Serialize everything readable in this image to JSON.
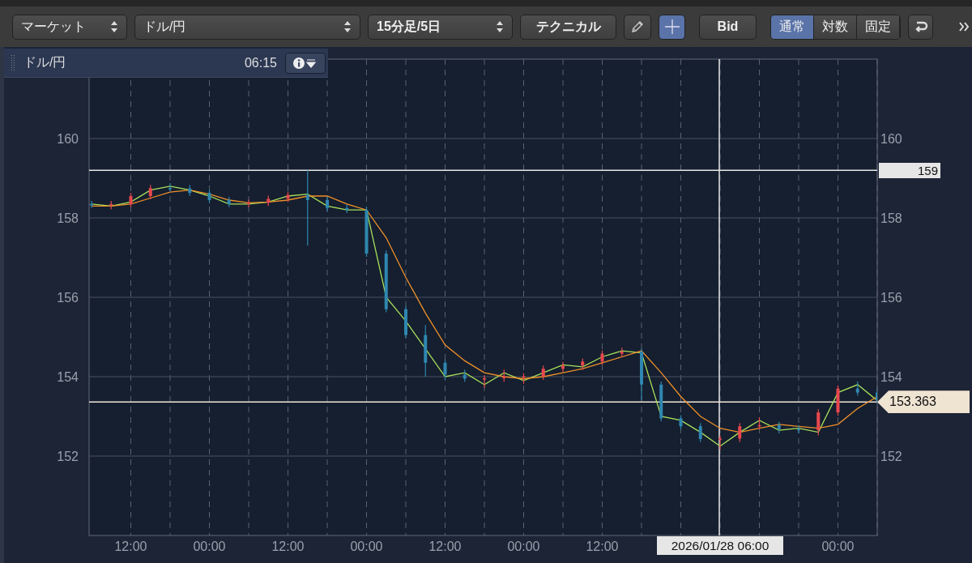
{
  "toolbar": {
    "market_select": "マーケット",
    "pair_select": "ドル/円",
    "period_select": "15分足/5日",
    "technical_button": "テクニカル",
    "draw_tool": {
      "selected": false
    },
    "crosshair_tool": {
      "selected": true
    },
    "price_button": "Bid",
    "scale_modes": [
      {
        "label": "通常",
        "selected": true
      },
      {
        "label": "対数",
        "selected": false
      },
      {
        "label": "固定",
        "selected": false
      }
    ]
  },
  "info_bar": {
    "pair": "ドル/円",
    "time": "06:15"
  },
  "chart": {
    "left_y_labels": [
      "160",
      "158",
      "156",
      "154",
      "152"
    ],
    "right_y_labels": [
      "160",
      "158",
      "156",
      "154",
      "152"
    ],
    "crosshair": {
      "price_label": "159",
      "time_label": "2026/01/28 06:00"
    },
    "last_price": {
      "label": "153.363"
    },
    "chart_data": {
      "type": "candlestick",
      "categories": [
        null,
        null,
        "12:00",
        null,
        null,
        null,
        "00:00",
        null,
        null,
        null,
        "12:00",
        null,
        null,
        null,
        "00:00",
        null,
        null,
        null,
        "12:00",
        null,
        null,
        null,
        "00:00",
        null,
        null,
        null,
        "12:00",
        null,
        null,
        null,
        null,
        null,
        null,
        null,
        null,
        null,
        null,
        null,
        "00:00",
        null,
        null
      ],
      "ohlc": [
        [
          158.35,
          158.43,
          158.25,
          158.33
        ],
        [
          158.33,
          158.43,
          158.22,
          158.35
        ],
        [
          158.35,
          158.63,
          158.27,
          158.55
        ],
        [
          158.55,
          158.83,
          158.47,
          158.75
        ],
        [
          158.75,
          158.88,
          158.67,
          158.74
        ],
        [
          158.74,
          158.83,
          158.55,
          158.63
        ],
        [
          158.63,
          158.71,
          158.37,
          158.45
        ],
        [
          158.45,
          158.53,
          158.27,
          158.35
        ],
        [
          158.35,
          158.46,
          158.27,
          158.38
        ],
        [
          158.38,
          158.56,
          158.3,
          158.48
        ],
        [
          158.48,
          158.66,
          158.4,
          158.58
        ],
        [
          158.58,
          159.2,
          157.3,
          158.45
        ],
        [
          158.45,
          158.53,
          158.17,
          158.25
        ],
        [
          158.25,
          158.33,
          158.12,
          158.2
        ],
        [
          158.2,
          158.28,
          157.02,
          157.1
        ],
        [
          157.1,
          157.18,
          155.62,
          155.7
        ],
        [
          155.7,
          155.78,
          154.97,
          155.05
        ],
        [
          155.05,
          155.3,
          154.0,
          154.35
        ],
        [
          154.35,
          154.43,
          153.92,
          154.05
        ],
        [
          154.05,
          154.18,
          153.87,
          153.95
        ],
        [
          153.95,
          154.03,
          153.72,
          153.96
        ],
        [
          153.96,
          154.18,
          153.87,
          154.0
        ],
        [
          154.0,
          154.09,
          153.82,
          154.01
        ],
        [
          154.01,
          154.28,
          153.92,
          154.2
        ],
        [
          154.2,
          154.38,
          154.12,
          154.28
        ],
        [
          154.28,
          154.46,
          154.17,
          154.38
        ],
        [
          154.38,
          154.66,
          154.3,
          154.58
        ],
        [
          154.58,
          154.73,
          154.5,
          154.63
        ],
        [
          154.63,
          154.71,
          153.4,
          153.8
        ],
        [
          153.8,
          153.88,
          152.87,
          152.95
        ],
        [
          152.95,
          153.03,
          152.67,
          152.75
        ],
        [
          152.75,
          152.83,
          152.35,
          152.43
        ],
        [
          152.43,
          152.52,
          152.17,
          152.44
        ],
        [
          152.44,
          152.83,
          152.35,
          152.75
        ],
        [
          152.75,
          152.98,
          152.67,
          152.78
        ],
        [
          152.78,
          152.86,
          152.57,
          152.68
        ],
        [
          152.68,
          152.78,
          152.57,
          152.65
        ],
        [
          152.65,
          153.18,
          152.52,
          153.1
        ],
        [
          153.1,
          153.78,
          153.02,
          153.7
        ],
        [
          153.7,
          153.88,
          153.52,
          153.6
        ],
        [
          153.6,
          153.68,
          153.32,
          153.4
        ]
      ],
      "series": [
        {
          "type": "line",
          "color": "#a8e05a",
          "values": [
            158.35,
            158.3,
            158.4,
            158.7,
            158.8,
            158.7,
            158.55,
            158.35,
            158.35,
            158.4,
            158.55,
            158.6,
            158.3,
            158.2,
            158.2,
            156.0,
            155.4,
            154.7,
            154.0,
            154.1,
            153.8,
            154.1,
            153.9,
            154.1,
            154.3,
            154.25,
            154.5,
            154.65,
            154.6,
            153.0,
            152.9,
            152.6,
            152.25,
            152.6,
            152.9,
            152.65,
            152.7,
            152.6,
            153.6,
            153.8,
            153.4
          ]
        },
        {
          "type": "line",
          "color": "#f0902a",
          "values": [
            158.3,
            158.3,
            158.35,
            158.5,
            158.65,
            158.7,
            158.6,
            158.45,
            158.38,
            158.4,
            158.45,
            158.55,
            158.55,
            158.35,
            158.2,
            157.5,
            156.5,
            155.6,
            154.8,
            154.4,
            154.1,
            154.0,
            153.95,
            154.0,
            154.1,
            154.2,
            154.35,
            154.5,
            154.65,
            154.1,
            153.5,
            153.0,
            152.7,
            152.6,
            152.7,
            152.8,
            152.75,
            152.7,
            152.8,
            153.2,
            153.5
          ]
        }
      ],
      "ylim": [
        150,
        162
      ],
      "yticks": [
        152,
        154,
        156,
        158,
        160
      ],
      "grid": true,
      "ref_lines": [
        {
          "axis": "y",
          "value": 159.2
        },
        {
          "axis": "y",
          "value": 153.363
        }
      ]
    }
  }
}
